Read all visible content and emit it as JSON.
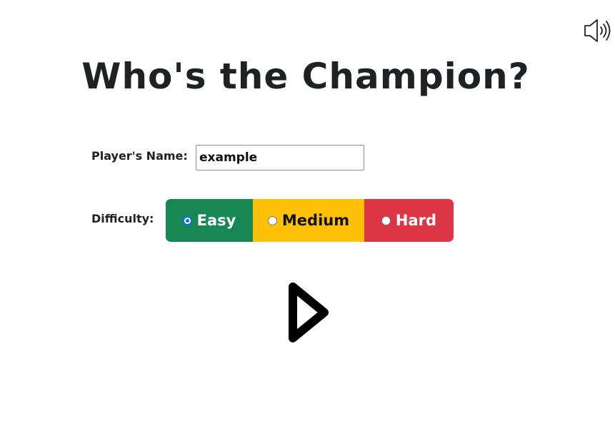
{
  "title": "Who's the Champion?",
  "sound_icon": "speaker-volume-icon",
  "player": {
    "label": "Player's Name:",
    "value": "example",
    "placeholder": ""
  },
  "difficulty": {
    "label": "Difficulty:",
    "selected": "Easy",
    "options": [
      {
        "label": "Easy",
        "color": "#198754"
      },
      {
        "label": "Medium",
        "color": "#ffc107"
      },
      {
        "label": "Hard",
        "color": "#dc3545"
      }
    ]
  },
  "play_icon": "play-icon"
}
